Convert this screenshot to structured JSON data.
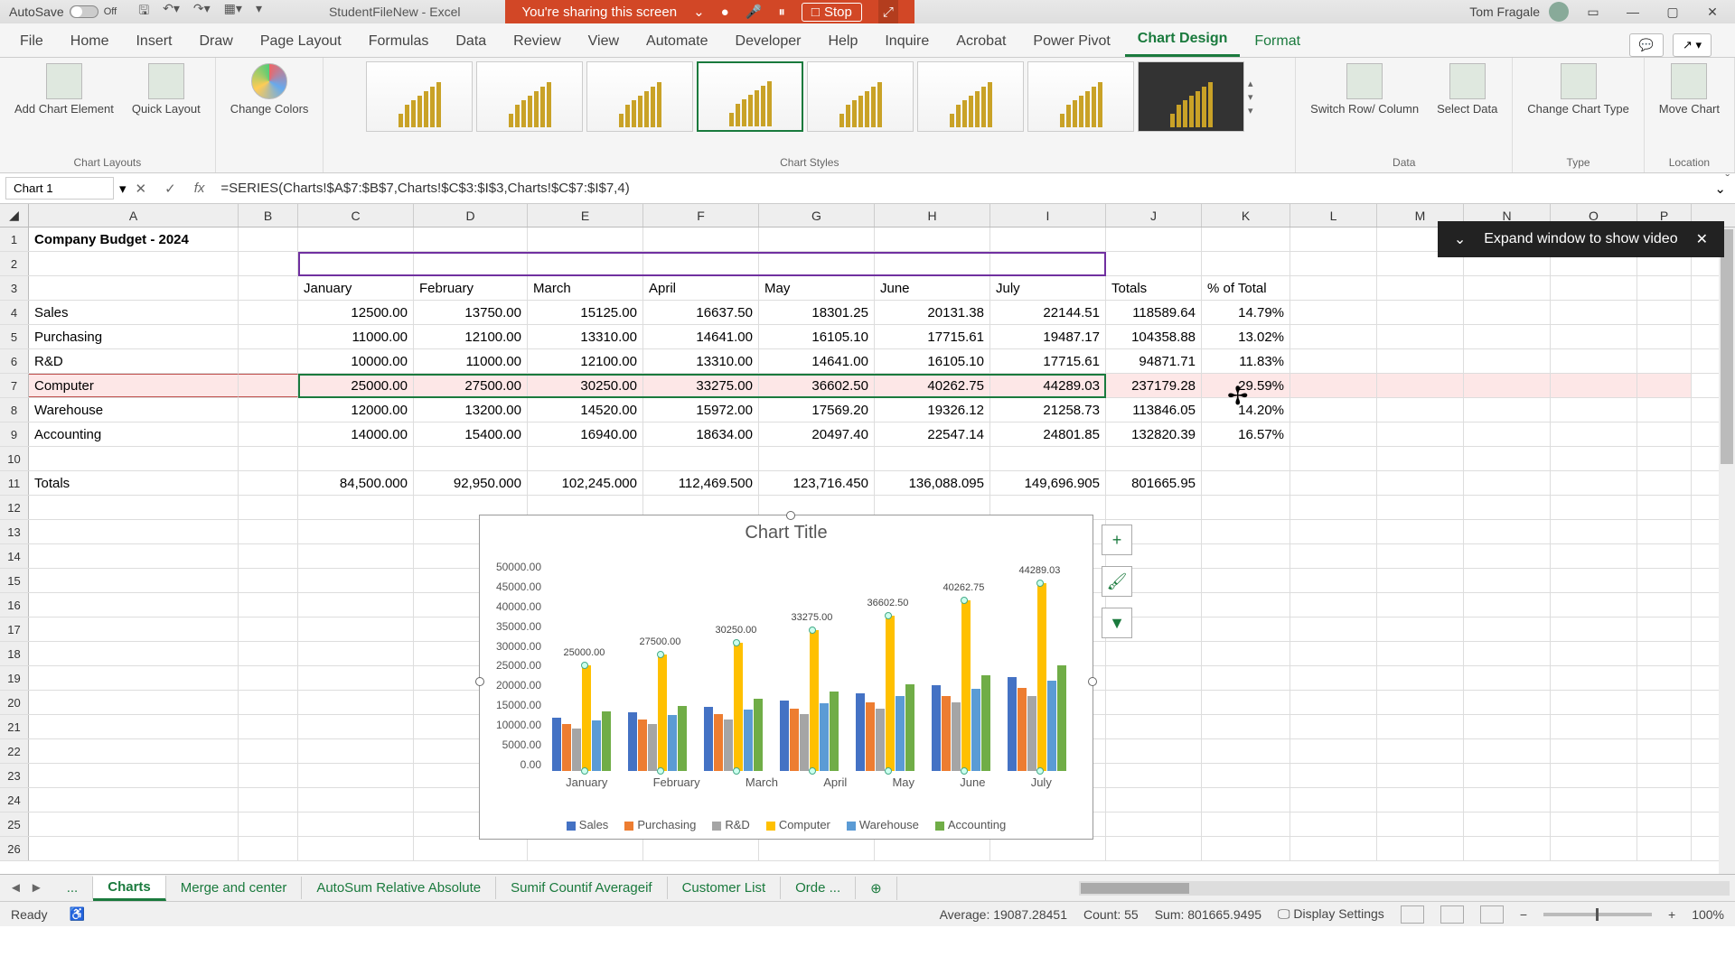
{
  "titlebar": {
    "autosave": "AutoSave",
    "autosave_state": "Off",
    "filename": "StudentFileNew - Excel",
    "sharing": "You're sharing this screen",
    "stop": "Stop",
    "user": "Tom Fragale"
  },
  "tabs": [
    "File",
    "Home",
    "Insert",
    "Draw",
    "Page Layout",
    "Formulas",
    "Data",
    "Review",
    "View",
    "Automate",
    "Developer",
    "Help",
    "Inquire",
    "Acrobat",
    "Power Pivot",
    "Chart Design",
    "Format"
  ],
  "ribbon": {
    "add_element": "Add Chart Element",
    "quick_layout": "Quick Layout",
    "change_colors": "Change Colors",
    "switch": "Switch Row/ Column",
    "select_data": "Select Data",
    "change_type": "Change Chart Type",
    "move_chart": "Move Chart",
    "g_layouts": "Chart Layouts",
    "g_styles": "Chart Styles",
    "g_data": "Data",
    "g_type": "Type",
    "g_location": "Location"
  },
  "namebox": "Chart 1",
  "formula": "=SERIES(Charts!$A$7:$B$7,Charts!$C$3:$I$3,Charts!$C$7:$I$7,4)",
  "notification": "Expand window to show video",
  "columns": [
    "A",
    "B",
    "C",
    "D",
    "E",
    "F",
    "G",
    "H",
    "I",
    "J",
    "K",
    "L",
    "M",
    "N",
    "O",
    "P"
  ],
  "title_cell": "Company Budget - 2024",
  "months": [
    "January",
    "February",
    "March",
    "April",
    "May",
    "June",
    "July"
  ],
  "totals_h": "Totals",
  "pct_h": "% of Total",
  "rows": [
    {
      "label": "Sales",
      "v": [
        "12500.00",
        "13750.00",
        "15125.00",
        "16637.50",
        "18301.25",
        "20131.38",
        "22144.51"
      ],
      "tot": "118589.64",
      "pct": "14.79%"
    },
    {
      "label": "Purchasing",
      "v": [
        "11000.00",
        "12100.00",
        "13310.00",
        "14641.00",
        "16105.10",
        "17715.61",
        "19487.17"
      ],
      "tot": "104358.88",
      "pct": "13.02%"
    },
    {
      "label": "R&D",
      "v": [
        "10000.00",
        "11000.00",
        "12100.00",
        "13310.00",
        "14641.00",
        "16105.10",
        "17715.61"
      ],
      "tot": "94871.71",
      "pct": "11.83%"
    },
    {
      "label": "Computer",
      "v": [
        "25000.00",
        "27500.00",
        "30250.00",
        "33275.00",
        "36602.50",
        "40262.75",
        "44289.03"
      ],
      "tot": "237179.28",
      "pct": "29.59%"
    },
    {
      "label": "Warehouse",
      "v": [
        "12000.00",
        "13200.00",
        "14520.00",
        "15972.00",
        "17569.20",
        "19326.12",
        "21258.73"
      ],
      "tot": "113846.05",
      "pct": "14.20%"
    },
    {
      "label": "Accounting",
      "v": [
        "14000.00",
        "15400.00",
        "16940.00",
        "18634.00",
        "20497.40",
        "22547.14",
        "24801.85"
      ],
      "tot": "132820.39",
      "pct": "16.57%"
    }
  ],
  "totals_row": {
    "label": "Totals",
    "v": [
      "84,500.000",
      "92,950.000",
      "102,245.000",
      "112,469.500",
      "123,716.450",
      "136,088.095",
      "149,696.905"
    ],
    "tot": "801665.95"
  },
  "chart": {
    "title": "Chart Title",
    "yticks": [
      "50000.00",
      "45000.00",
      "40000.00",
      "35000.00",
      "30000.00",
      "25000.00",
      "20000.00",
      "15000.00",
      "10000.00",
      "5000.00",
      "0.00"
    ],
    "labels": [
      "25000.00",
      "27500.00",
      "30250.00",
      "33275.00",
      "36602.50",
      "40262.75",
      "44289.03"
    ]
  },
  "chart_data": {
    "type": "bar",
    "title": "Chart Title",
    "categories": [
      "January",
      "February",
      "March",
      "April",
      "May",
      "June",
      "July"
    ],
    "series": [
      {
        "name": "Sales",
        "values": [
          12500,
          13750,
          15125,
          16637.5,
          18301.25,
          20131.38,
          22144.51
        ]
      },
      {
        "name": "Purchasing",
        "values": [
          11000,
          12100,
          13310,
          14641,
          16105.1,
          17715.61,
          19487.17
        ]
      },
      {
        "name": "R&D",
        "values": [
          10000,
          11000,
          12100,
          13310,
          14641,
          16105.1,
          17715.61
        ]
      },
      {
        "name": "Computer",
        "values": [
          25000,
          27500,
          30250,
          33275,
          36602.5,
          40262.75,
          44289.03
        ]
      },
      {
        "name": "Warehouse",
        "values": [
          12000,
          13200,
          14520,
          15972,
          17569.2,
          19326.12,
          21258.73
        ]
      },
      {
        "name": "Accounting",
        "values": [
          14000,
          15400,
          16940,
          18634,
          20497.4,
          22547.14,
          24801.85
        ]
      }
    ],
    "ylim": [
      0,
      50000
    ],
    "ylabel": "",
    "xlabel": ""
  },
  "sheets": [
    "...",
    "Charts",
    "Merge and center",
    "AutoSum Relative Absolute",
    "Sumif Countif Averageif",
    "Customer List",
    "Orde ..."
  ],
  "status": {
    "ready": "Ready",
    "avg": "Average: 19087.28451",
    "count": "Count: 55",
    "sum": "Sum: 801665.9495",
    "disp": "Display Settings",
    "zoom": "100%"
  }
}
